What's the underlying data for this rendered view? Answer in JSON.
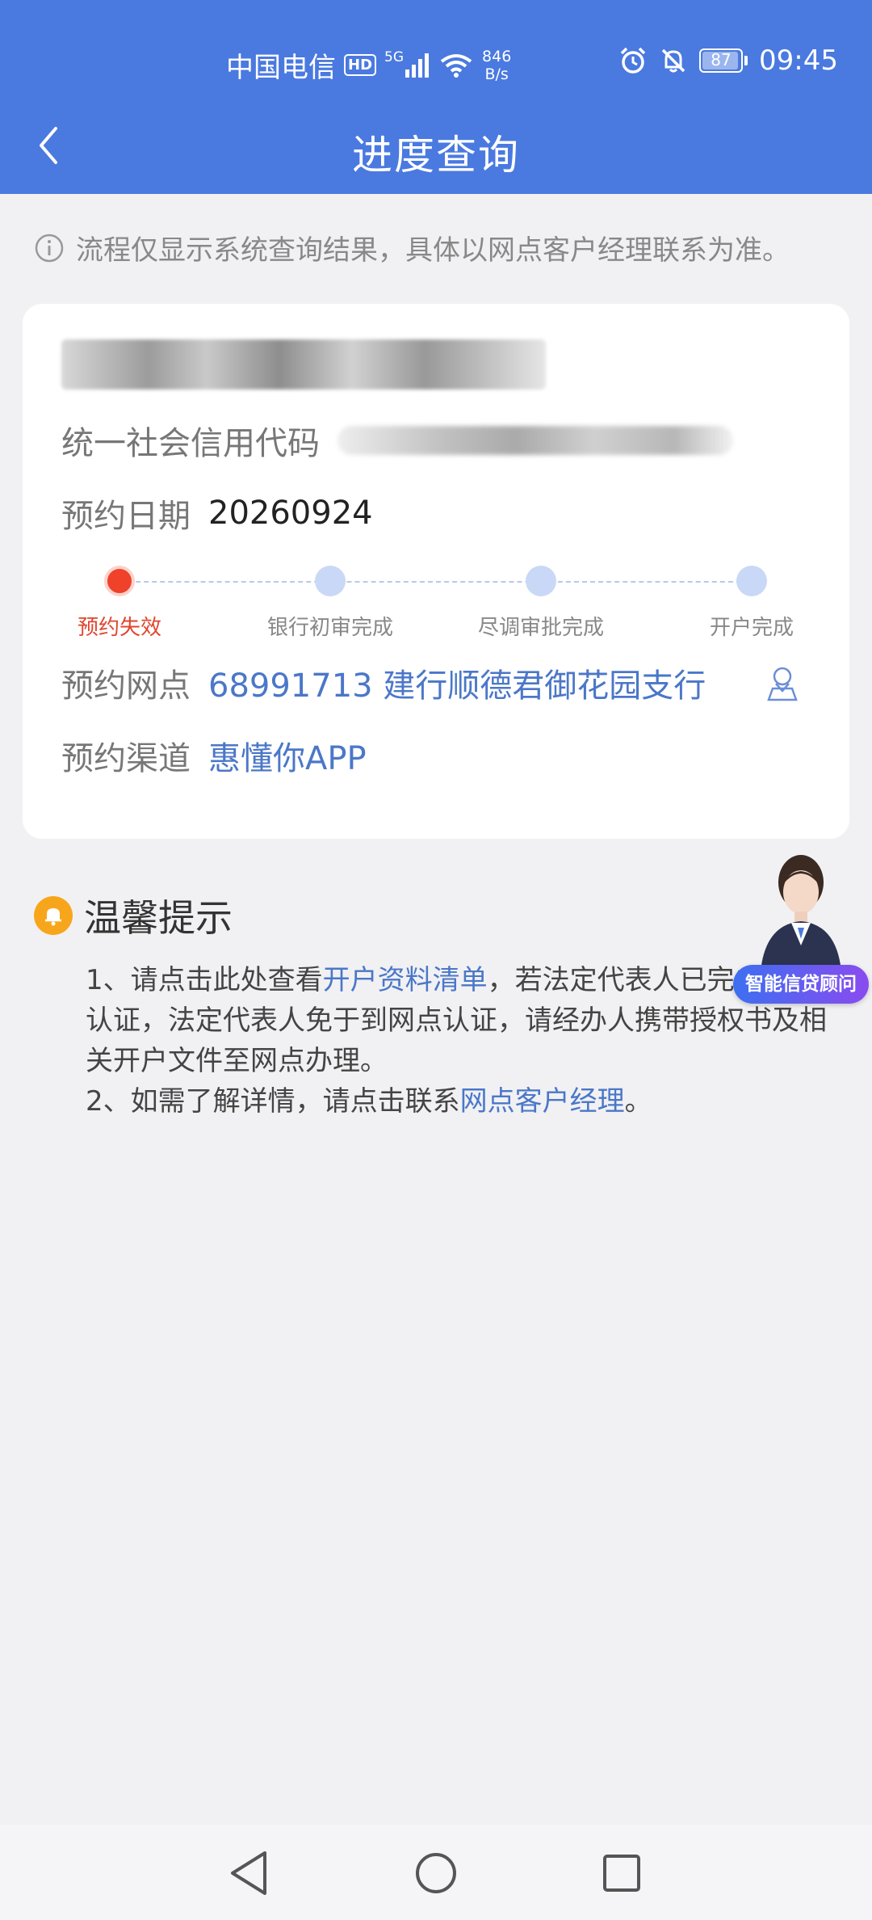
{
  "status_bar": {
    "carrier": "中国电信",
    "hd": "HD",
    "network": "5G",
    "speed_value": "846",
    "speed_unit": "B/s",
    "battery": "87",
    "time": "09:45"
  },
  "header": {
    "title": "进度查询"
  },
  "notice": {
    "text": "流程仅显示系统查询结果，具体以网点客户经理联系为准。"
  },
  "card": {
    "credit_code_label": "统一社会信用代码",
    "appointment_date_label": "预约日期",
    "appointment_date_value": "20260924",
    "steps": [
      {
        "label": "预约失效",
        "active": true
      },
      {
        "label": "银行初审完成",
        "active": false
      },
      {
        "label": "尽调审批完成",
        "active": false
      },
      {
        "label": "开户完成",
        "active": false
      }
    ],
    "branch_label": "预约网点",
    "branch_value": "68991713 建行顺德君御花园支行",
    "channel_label": "预约渠道",
    "channel_value": "惠懂你APP"
  },
  "tips": {
    "title": "温馨提示",
    "line1_prefix": "1、请点击此处查看",
    "line1_link": "开户资料清单",
    "line1_suffix": "，若法定代表人已完成实名制认证，法定代表人免于到网点认证，请经办人携带授权书及相关开户文件至网点办理。",
    "line2_prefix": "2、如需了解详情，请点击联系",
    "line2_link": "网点客户经理",
    "line2_suffix": "。"
  },
  "assistant": {
    "label": "智能信贷顾问"
  },
  "colors": {
    "header_bg": "#4a79e0",
    "link": "#4b77c8",
    "step_active": "#f0412b",
    "step_inactive": "#c9d8f6",
    "bell": "#f7a61c"
  }
}
